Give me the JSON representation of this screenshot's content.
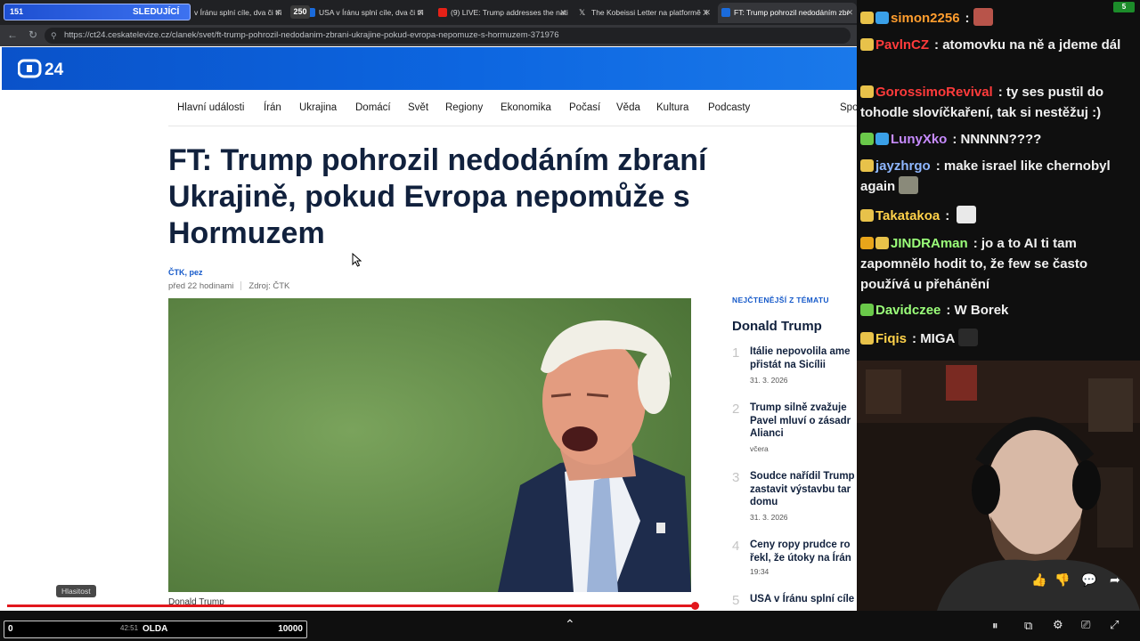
{
  "overlay": {
    "viewer_count": "151",
    "following_label": "SLEDUJÍCÍ",
    "score_badge": "250",
    "bottom_left": "0",
    "bottom_name": "OLDA",
    "bottom_right": "10000",
    "bottom_timer": "42:51"
  },
  "browser": {
    "tabs": [
      {
        "title": "v Íránu splní cíle, dva či tři",
        "favicon": "site"
      },
      {
        "title": "USA v Íránu splní cíle, dva či tři",
        "favicon": "site"
      },
      {
        "title": "(9) LIVE: Trump addresses the nati",
        "favicon": "youtube"
      },
      {
        "title": "The Kobeissi Letter na platformě X",
        "favicon": "x"
      },
      {
        "title": "FT: Trump pohrozil nedodáním zbr",
        "favicon": "site",
        "active": true
      }
    ],
    "url": "https://ct24.ceskatelevize.cz/clanek/svet/ft-trump-pohrozil-nedodanim-zbrani-ukrajine-pokud-evropa-nepomuze-s-hormuzem-371976"
  },
  "site": {
    "logo_text": "24",
    "nav": [
      "Hlavní události",
      "Írán",
      "Ukrajina",
      "Domácí",
      "Svět",
      "Regiony",
      "Ekonomika",
      "Počasí",
      "Věda",
      "Kultura",
      "Podcasty",
      "Spo"
    ],
    "article": {
      "headline": "FT: Trump pohrozil nedodáním zbraní Ukrajině, pokud Evropa nepomůže s Hormuzem",
      "byline": "ČTK, pez",
      "time": "před 22 hodinami",
      "source": "Zdroj: ČTK",
      "caption": "Donald Trump"
    },
    "related": {
      "kicker": "NEJČTENĚJŠÍ Z TÉMATU",
      "title": "Donald Trump",
      "items": [
        {
          "num": "1",
          "title": "Itálie nepovolila ame přistát na Sicílii",
          "date": "31. 3. 2026"
        },
        {
          "num": "2",
          "title": "Trump silně zvažuje Pavel mluví o zásadr Alianci",
          "date": "včera"
        },
        {
          "num": "3",
          "title": "Soudce nařídil Trump zastavit výstavbu tar domu",
          "date": "31. 3. 2026"
        },
        {
          "num": "4",
          "title": "Ceny ropy prudce ro řekl, že útoky na Írán",
          "date": "19:34"
        },
        {
          "num": "5",
          "title": "USA v Íránu splní cíle",
          "date": ""
        }
      ]
    }
  },
  "video": {
    "tooltip": "Hlasitost",
    "progress_fraction": 0.81
  },
  "chat": {
    "messages": [
      {
        "user": "simon2256",
        "color": "#ff9d2e",
        "text": "",
        "emote": true
      },
      {
        "user": "PavlnCZ",
        "color": "#ff3b3b",
        "text": "atomovku na ně a jdeme dál"
      },
      {
        "user": "GorossimoRevival",
        "color": "#ff3b3b",
        "text": "ty ses pustil do tohodle slovíčkaření, tak si nestěžuj :)"
      },
      {
        "user": "LunyXko",
        "color": "#c78bff",
        "text": "NNNNN????"
      },
      {
        "user": "jayzhrgo",
        "color": "#8fb7ff",
        "text": "make israel like chernobyl again",
        "emote": true
      },
      {
        "user": "Takatakoa",
        "color": "#ffd24a",
        "text": "",
        "emote": true
      },
      {
        "user": "JINDRAman",
        "color": "#9bff7a",
        "text": "jo a to AI ti tam zapomnělo hodit to, že few se často používá u přehánění"
      },
      {
        "user": "Davidczee",
        "color": "#9bff7a",
        "text": "W Borek"
      },
      {
        "user": "Fiqis",
        "color": "#ffd24a",
        "text": "MIGA",
        "emote": true
      }
    ],
    "badge_count": "5"
  },
  "colors": {
    "site_blue": "#0d66e0",
    "headline": "#11213d",
    "progress_red": "#e2171d"
  }
}
